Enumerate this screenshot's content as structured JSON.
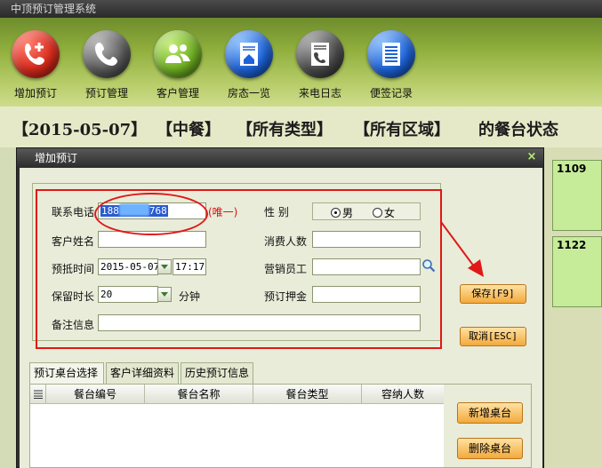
{
  "app": {
    "title": "中顶预订管理系统"
  },
  "toolbar": {
    "items": [
      {
        "label": "增加预订",
        "icon": "phone-add-icon"
      },
      {
        "label": "预订管理",
        "icon": "phone-handset-icon"
      },
      {
        "label": "客户管理",
        "icon": "users-icon"
      },
      {
        "label": "房态一览",
        "icon": "house-icon"
      },
      {
        "label": "来电日志",
        "icon": "phone-log-icon"
      },
      {
        "label": "便签记录",
        "icon": "notes-icon"
      }
    ]
  },
  "status_bar": {
    "date": "【2015-05-07】",
    "meal": "【中餐】",
    "type": "【所有类型】",
    "area": "【所有区域】",
    "suffix": "的餐台状态"
  },
  "board": {
    "tables": [
      "1109",
      "1122"
    ]
  },
  "dialog": {
    "title": "增加预订",
    "close": "×",
    "form": {
      "phone_label": "联系电话",
      "phone_prefix": "188",
      "phone_suffix": "768",
      "unique_note": "(唯一)",
      "gender_label": "性    别",
      "gender_male": "男",
      "gender_female": "女",
      "customer_name_label": "客户姓名",
      "guest_count_label": "消费人数",
      "arrival_time_label": "预抵时间",
      "arrival_date": "2015-05-07",
      "arrival_time": "17:17",
      "sales_staff_label": "营销员工",
      "hold_duration_label": "保留时长",
      "hold_duration": "20",
      "hold_unit": "分钟",
      "deposit_label": "预订押金",
      "notes_label": "备注信息"
    },
    "buttons": {
      "save": "保存[F9]",
      "cancel": "取消[ESC]"
    },
    "tabs": [
      "预订桌台选择",
      "客户详细资料",
      "历史预订信息"
    ],
    "grid": {
      "columns": [
        "餐台编号",
        "餐台名称",
        "餐台类型",
        "容纳人数"
      ]
    },
    "side_buttons": {
      "add_table": "新增桌台",
      "delete_table": "删除桌台"
    }
  },
  "colors": {
    "accent_red": "#e01818",
    "toolbar_green": "#8fae3c",
    "button_orange": "#f3a93c"
  }
}
